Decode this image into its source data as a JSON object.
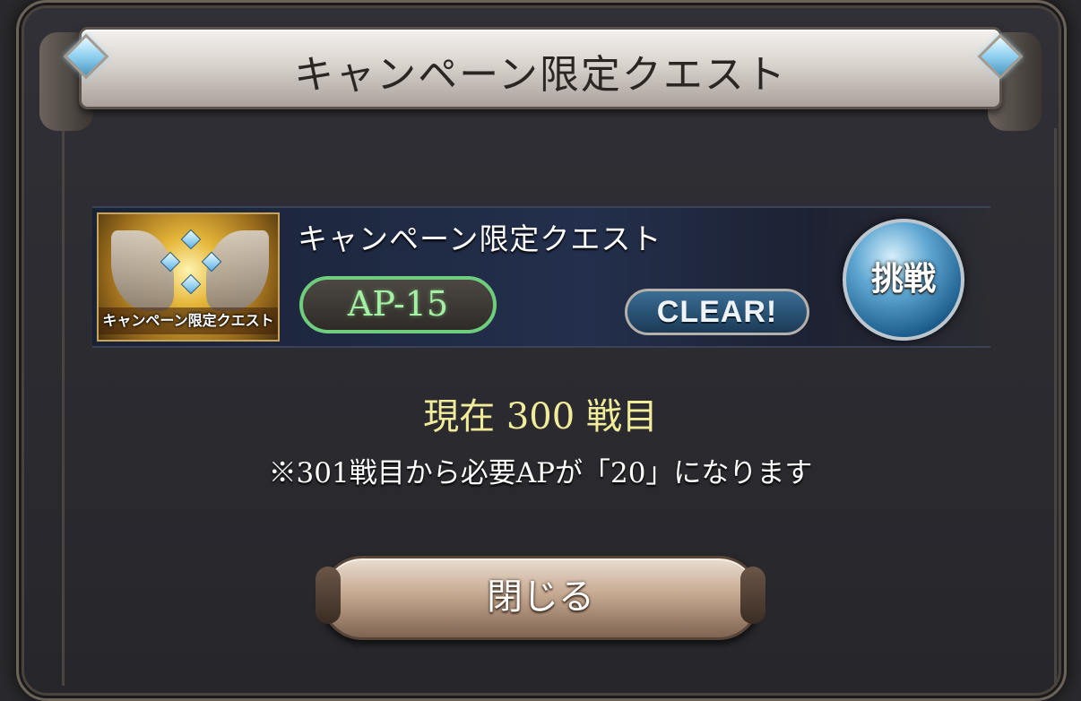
{
  "dialog": {
    "title": "キャンペーン限定クエスト",
    "quest": {
      "thumbnail_caption": "キャンペーン限定クエスト",
      "name": "キャンペーン限定クエスト",
      "ap_cost": "AP-15",
      "clear_badge": "CLEAR!",
      "challenge_label": "挑戦"
    },
    "battle_count": "現在 300 戦目",
    "notice": "※301戦目から必要APが「20」になります",
    "close_label": "閉じる"
  },
  "colors": {
    "battle_count_text": "#f1ec9a",
    "ap_badge_border": "#6fce7d",
    "challenge_button": "#5fa7d2"
  },
  "icons": [
    "diamond-gem-icon",
    "quest-thumbnail-image"
  ]
}
